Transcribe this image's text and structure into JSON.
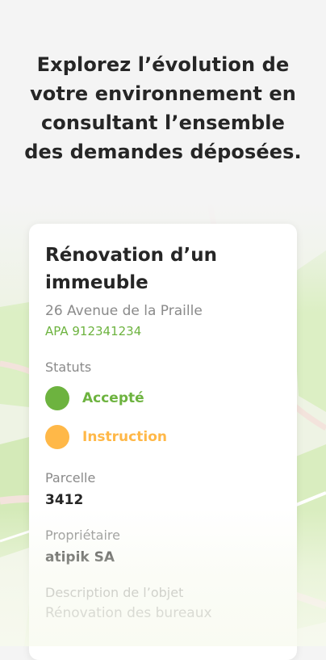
{
  "headline": {
    "lines": [
      "Explorez l’évolution de",
      "votre environnement en",
      "consultant l’ensemble",
      "des demandes déposées."
    ]
  },
  "card": {
    "title_lines": [
      "Rénovation d’un",
      "immeuble"
    ],
    "address": "26 Avenue de la Praille",
    "reference": "APA 912341234",
    "statuts_label": "Statuts",
    "statuses": [
      {
        "label": "Accepté",
        "color": "#6db33f"
      },
      {
        "label": "Instruction",
        "color": "#ffb848"
      }
    ],
    "parcelle_label": "Parcelle",
    "parcelle_value": "3412",
    "proprietaire_label": "Propriétaire",
    "proprietaire_value": "atipik SA",
    "description_label": "Description de l’objet",
    "description_value": "Rénovation des bureaux"
  },
  "colors": {
    "accent_green": "#6db33f",
    "accent_orange": "#ffb848",
    "map_green": "#dcefc4",
    "map_road": "#f3e3dc"
  }
}
